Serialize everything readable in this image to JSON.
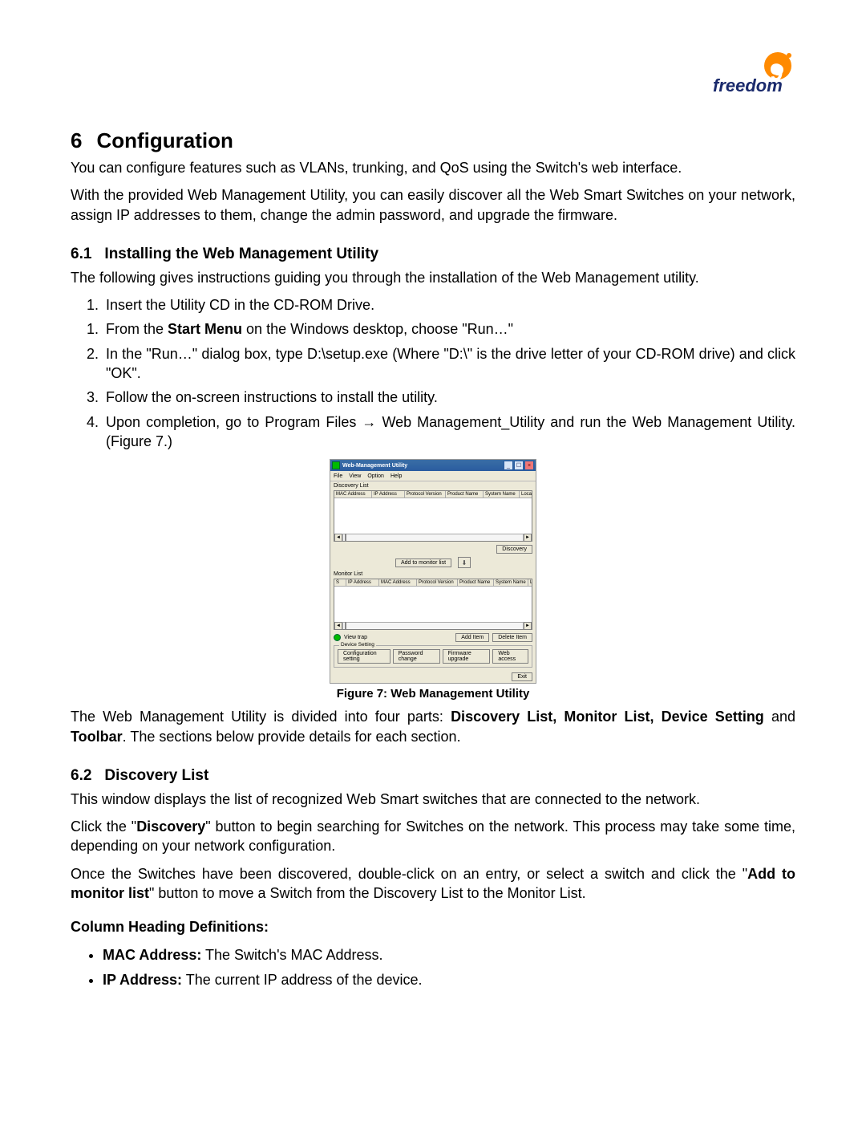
{
  "logo": {
    "brand": "freedom",
    "accent": "9",
    "brand_color": "#1a2a6c",
    "accent_color": "#ff8a00"
  },
  "h1": {
    "num": "6",
    "title": "Configuration"
  },
  "p1": "You can configure features such as VLANs, trunking, and QoS using the Switch's web interface.",
  "p2": "With the provided Web Management Utility, you can easily discover all the Web Smart Switches on your network, assign IP addresses to them, change the admin password, and upgrade the firmware.",
  "h2a": {
    "num": "6.1",
    "title": "Installing the Web Management Utility"
  },
  "p3": "The following gives instructions guiding you through the installation of the Web Management utility.",
  "steps": {
    "s1": "Insert the Utility CD in the CD-ROM Drive.",
    "s2a": "From the ",
    "s2b": "Start Menu",
    "s2c": " on the Windows desktop, choose \"Run…\"",
    "s3": "In the \"Run…\" dialog box, type D:\\setup.exe (Where \"D:\\\" is the drive letter of your CD-ROM drive) and click \"OK\".",
    "s4": "Follow the on-screen instructions to install the utility.",
    "s5": "Upon completion, go to Program Files → Web Management_Utility and run the Web Management Utility. (Figure 7.)"
  },
  "figure7": {
    "caption": "Figure 7: Web Management Utility",
    "window_title": "Web-Management Utility",
    "menu": {
      "file": "File",
      "view": "View",
      "option": "Option",
      "help": "Help"
    },
    "discovery_label": "Discovery List",
    "discovery_cols": {
      "mac": "MAC Address",
      "ip": "IP Address",
      "proto": "Protocol Version",
      "prod": "Product Name",
      "sys": "System Name",
      "loc": "Loca"
    },
    "discovery_btn": "Discovery",
    "add_to_monitor_btn": "Add to monitor list",
    "monitor_label": "Monitor List",
    "monitor_cols": {
      "s": "S",
      "ip": "IP Address",
      "mac": "MAC Address",
      "proto": "Protocol Version",
      "prod": "Product Name",
      "sys": "System Name",
      "loc": "Loca"
    },
    "view_trap": "View trap",
    "add_item_btn": "Add Item",
    "delete_item_btn": "Delete Item",
    "device_setting_label": "Device Setting",
    "config_btn": "Configuration setting",
    "pwd_btn": "Password change",
    "fw_btn": "Firmware upgrade",
    "web_btn": "Web access",
    "exit_btn": "Exit"
  },
  "p4a": "The Web Management Utility is divided into four parts: ",
  "p4b": "Discovery List, Monitor List, Device Setting",
  "p4c": " and ",
  "p4d": "Toolbar",
  "p4e": ".  The sections below provide details for each section.",
  "h2b": {
    "num": "6.2",
    "title": "Discovery List"
  },
  "p5": "This window displays the list of recognized Web Smart switches that are connected to the network.",
  "p6a": "Click the \"",
  "p6b": "Discovery",
  "p6c": "\" button to begin searching for Switches on the network.  This process may take some time, depending on your network configuration.",
  "p7a": "Once the Switches have been discovered, double-click on an entry, or select a switch and click the \"",
  "p7b": "Add to monitor list",
  "p7c": "\" button to move a Switch from the Discovery List to the Monitor List.",
  "coldef_heading": "Column Heading Definitions:",
  "coldef": {
    "mac_b": "MAC Address:",
    "mac_t": " The Switch's MAC Address.",
    "ip_b": "IP Address:",
    "ip_t": " The current IP address of the device."
  }
}
